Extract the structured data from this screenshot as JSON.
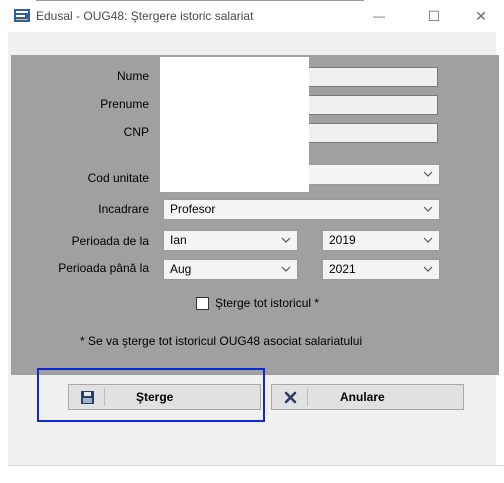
{
  "window": {
    "title": "Edusal - OUG48: Ştergere istoric salariat",
    "minimize": "—",
    "maximize": "☐",
    "close": "✕",
    "app_icon": "edusal-app-icon"
  },
  "form": {
    "nume_label": "Nume",
    "prenume_label": "Prenume",
    "cnp_label": "CNP",
    "cod_unitate_label": "Cod unitate",
    "incadrare_label": "Incadrare",
    "incadrare_value": "Profesor",
    "perioada_de_la_label": "Perioada de la",
    "perioada_de_la_month": "Ian",
    "perioada_de_la_year": "2019",
    "perioada_pana_la_label": "Perioada până la",
    "perioada_pana_la_month": "Aug",
    "perioada_pana_la_year": "2021",
    "sterge_tot_checkbox_label": "Şterge tot istoricul *",
    "sterge_tot_checked": false,
    "note": "* Se va şterge tot istoricul OUG48 asociat salariatului"
  },
  "buttons": {
    "sterge_label": "Şterge",
    "sterge_icon": "floppy-disk-icon",
    "anulare_label": "Anulare",
    "anulare_icon": "x-cancel-icon"
  }
}
